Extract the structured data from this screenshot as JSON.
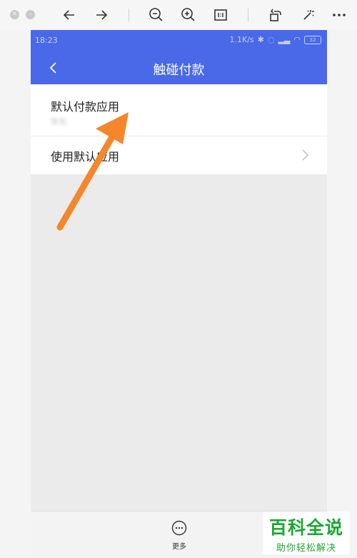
{
  "status_bar": {
    "time": "18:23",
    "network_speed": "1.1K/s",
    "battery": "32"
  },
  "header": {
    "title": "触碰付款"
  },
  "settings": {
    "items": [
      {
        "label": "默认付款应用",
        "value": "华为"
      },
      {
        "label": "使用默认应用"
      }
    ]
  },
  "bottom_bar": {
    "more_label": "更多"
  },
  "watermark": {
    "title": "百科全说",
    "subtitle": "助你轻松解决"
  },
  "colors": {
    "header_bg": "#4a69e8",
    "arrow": "#f5862a",
    "watermark": "#1ba832"
  }
}
